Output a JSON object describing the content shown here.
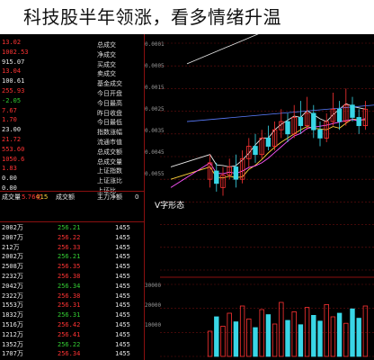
{
  "headline": "科技股半年领涨，看多情绪升温",
  "quote_panel": {
    "rows": [
      {
        "value": "13.02",
        "color": "red"
      },
      {
        "value": "1002.53",
        "color": "red"
      },
      {
        "value": "915.07",
        "color": "white"
      },
      {
        "value": "13.04",
        "color": "red"
      },
      {
        "value": "100.61",
        "color": "white"
      },
      {
        "value": "255.93",
        "color": "red"
      },
      {
        "value": "-2.05",
        "color": "green"
      },
      {
        "value": "7.67",
        "color": "red"
      },
      {
        "value": "1.70",
        "color": "red"
      },
      {
        "value": "23.00",
        "color": "white"
      },
      {
        "value": "21.72",
        "color": "red"
      },
      {
        "value": "553.60",
        "color": "red"
      },
      {
        "value": "1050.6",
        "color": "red"
      },
      {
        "value": "1.83",
        "color": "red"
      },
      {
        "value": "0.00",
        "color": "white"
      },
      {
        "value": "0.00",
        "color": "white"
      }
    ],
    "labels": [
      "总成交",
      "净成交",
      "买成交",
      "卖成交",
      "基金成交",
      "今日开盘",
      "今日最高",
      "昨日收盘",
      "今日最低",
      "指数涨幅",
      "流通市值",
      "总成交额",
      "总成交量",
      "上证指数",
      "上证涨比",
      "上证比"
    ],
    "sub_tabs": [
      "成交量",
      "成交额",
      "主力净额"
    ],
    "sub_values": [
      "415",
      "5.76亿",
      "0"
    ]
  },
  "ticks": [
    {
      "time": "1455",
      "price": "256.21",
      "vol": "2002万"
    },
    {
      "time": "1455",
      "price": "256.22",
      "vol": "2007万"
    },
    {
      "time": "1455",
      "price": "256.33",
      "vol": "212万"
    },
    {
      "time": "1455",
      "price": "256.21",
      "vol": "2002万"
    },
    {
      "time": "1455",
      "price": "256.35",
      "vol": "2508万"
    },
    {
      "time": "1455",
      "price": "256.38",
      "vol": "2232万"
    },
    {
      "time": "1455",
      "price": "256.34",
      "vol": "2042万"
    },
    {
      "time": "1455",
      "price": "256.38",
      "vol": "2322万"
    },
    {
      "time": "1455",
      "price": "256.31",
      "vol": "1553万"
    },
    {
      "time": "1455",
      "price": "256.31",
      "vol": "1832万"
    },
    {
      "time": "1455",
      "price": "256.42",
      "vol": "1516万"
    },
    {
      "time": "1455",
      "price": "256.41",
      "vol": "1212万"
    },
    {
      "time": "1455",
      "price": "256.22",
      "vol": "1352万"
    },
    {
      "time": "1455",
      "price": "256.34",
      "vol": "1707万"
    }
  ],
  "chart_data": {
    "type": "candlestick",
    "annotation": "V字形态",
    "price_axis": [
      "0.0001",
      "0.0005",
      "0.0015",
      "0.0025",
      "0.0035",
      "0.0045",
      "0.0055"
    ],
    "volume_axis": [
      "30000",
      "20000",
      "10000"
    ],
    "candles": [
      {
        "o": 0.52,
        "c": 0.56,
        "h": 0.58,
        "l": 0.5
      },
      {
        "o": 0.54,
        "c": 0.51,
        "h": 0.56,
        "l": 0.49
      },
      {
        "o": 0.5,
        "c": 0.53,
        "h": 0.55,
        "l": 0.48
      },
      {
        "o": 0.53,
        "c": 0.55,
        "h": 0.57,
        "l": 0.52
      },
      {
        "o": 0.55,
        "c": 0.52,
        "h": 0.58,
        "l": 0.5
      },
      {
        "o": 0.52,
        "c": 0.57,
        "h": 0.59,
        "l": 0.51
      },
      {
        "o": 0.57,
        "c": 0.6,
        "h": 0.62,
        "l": 0.55
      },
      {
        "o": 0.6,
        "c": 0.58,
        "h": 0.63,
        "l": 0.56
      },
      {
        "o": 0.58,
        "c": 0.62,
        "h": 0.64,
        "l": 0.57
      },
      {
        "o": 0.62,
        "c": 0.6,
        "h": 0.65,
        "l": 0.59
      },
      {
        "o": 0.6,
        "c": 0.64,
        "h": 0.66,
        "l": 0.59
      },
      {
        "o": 0.64,
        "c": 0.66,
        "h": 0.69,
        "l": 0.62
      },
      {
        "o": 0.66,
        "c": 0.63,
        "h": 0.68,
        "l": 0.61
      },
      {
        "o": 0.63,
        "c": 0.67,
        "h": 0.7,
        "l": 0.62
      },
      {
        "o": 0.67,
        "c": 0.65,
        "h": 0.71,
        "l": 0.63
      },
      {
        "o": 0.65,
        "c": 0.68,
        "h": 0.72,
        "l": 0.64
      },
      {
        "o": 0.68,
        "c": 0.64,
        "h": 0.7,
        "l": 0.62
      },
      {
        "o": 0.64,
        "c": 0.62,
        "h": 0.66,
        "l": 0.6
      },
      {
        "o": 0.62,
        "c": 0.66,
        "h": 0.68,
        "l": 0.61
      },
      {
        "o": 0.66,
        "c": 0.69,
        "h": 0.73,
        "l": 0.65
      },
      {
        "o": 0.69,
        "c": 0.66,
        "h": 0.71,
        "l": 0.64
      },
      {
        "o": 0.66,
        "c": 0.7,
        "h": 0.74,
        "l": 0.65
      },
      {
        "o": 0.7,
        "c": 0.67,
        "h": 0.72,
        "l": 0.66
      },
      {
        "o": 0.67,
        "c": 0.65,
        "h": 0.69,
        "l": 0.63
      },
      {
        "o": 0.65,
        "c": 0.69,
        "h": 0.71,
        "l": 0.64
      }
    ],
    "volumes": [
      0.35,
      0.55,
      0.42,
      0.6,
      0.48,
      0.7,
      0.52,
      0.4,
      0.65,
      0.58,
      0.45,
      0.75,
      0.5,
      0.62,
      0.44,
      0.68,
      0.57,
      0.49,
      0.72,
      0.55,
      0.6,
      0.46,
      0.66,
      0.53,
      0.7
    ],
    "colors": {
      "up": "#ff3333",
      "down": "#39d6e6",
      "ma1": "#e8e8e8",
      "ma2": "#ffd23a",
      "ma3": "#ff55ff",
      "grid": "#6b0f0f"
    }
  }
}
